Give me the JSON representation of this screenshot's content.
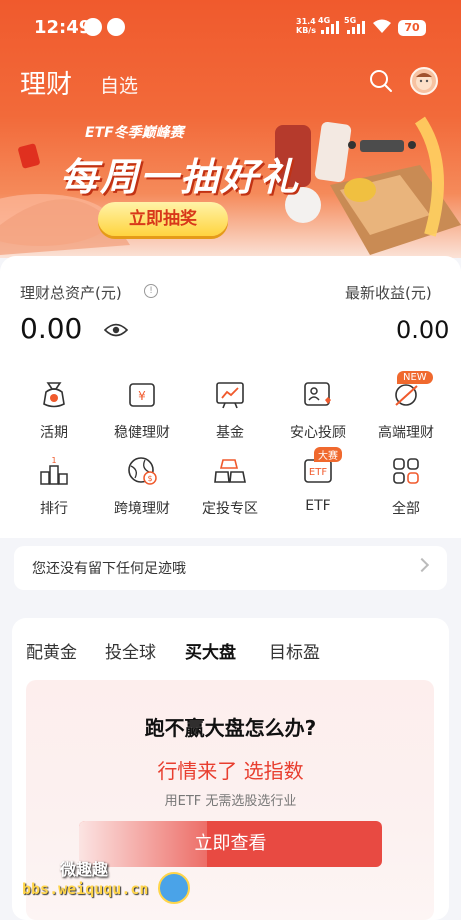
{
  "status_bar": {
    "time": "12:49",
    "net_rate_top": "31.4",
    "net_rate_bottom": "KB/s",
    "sig1": "4G",
    "sig2": "5G",
    "battery": "70"
  },
  "nav": {
    "title": "理财",
    "tab": "自选"
  },
  "banner": {
    "subtitle": "ETF冬季巅峰赛",
    "title": "每周一抽好礼",
    "button": "立即抽奖"
  },
  "assets": {
    "total_label": "理财总资产(元)",
    "total_value": "0.00",
    "earnings_label": "最新收益(元)",
    "earnings_value": "0.00"
  },
  "grid": [
    {
      "label": "活期",
      "icon": "moneybag-icon"
    },
    {
      "label": "稳健理财",
      "icon": "yen-wallet-icon"
    },
    {
      "label": "基金",
      "icon": "chart-board-icon"
    },
    {
      "label": "安心投顾",
      "icon": "advisor-icon"
    },
    {
      "label": "高端理财",
      "icon": "premium-icon"
    },
    {
      "label": "排行",
      "icon": "podium-icon"
    },
    {
      "label": "跨境理财",
      "icon": "globe-dollar-icon"
    },
    {
      "label": "定投专区",
      "icon": "gold-bars-icon"
    },
    {
      "label": "ETF",
      "icon": "etf-icon"
    },
    {
      "label": "全部",
      "icon": "grid-all-icon"
    }
  ],
  "badges": {
    "new": "NEW",
    "race": "大赛"
  },
  "footprint": {
    "text": "您还没有留下任何足迹哦"
  },
  "section": {
    "tabs": [
      "配黄金",
      "投全球",
      "买大盘",
      "目标盈"
    ],
    "active_tab": "买大盘",
    "question": "跑不赢大盘怎么办?",
    "highlight": "行情来了 选指数",
    "sub": "用ETF 无需选股选行业",
    "cta": "立即查看"
  },
  "watermark": {
    "line1": "微趣趣",
    "line2": "bbs.weiququ.cn"
  },
  "colors": {
    "accent": "#f05a2d",
    "cta": "#e84a42",
    "highlight": "#e83e2f"
  }
}
